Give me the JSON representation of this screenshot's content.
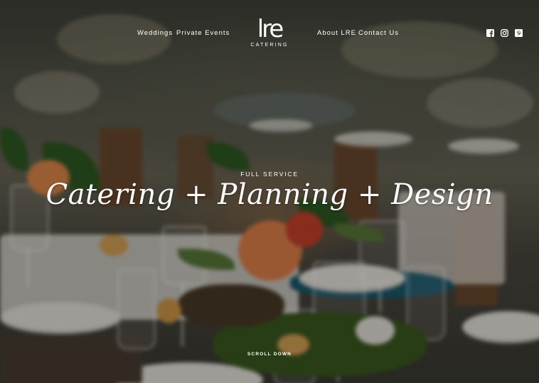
{
  "nav": {
    "left_links": [
      "Weddings",
      "Private Events"
    ],
    "right_links": [
      "About LRE",
      "Contact Us"
    ]
  },
  "logo": {
    "mark": "lre",
    "subtitle": "CATERING"
  },
  "social": [
    "facebook-icon",
    "instagram-icon",
    "pinterest-icon"
  ],
  "hero": {
    "eyebrow": "FULL SERVICE",
    "headline": "Catering + Planning + Design",
    "scroll_label": "SCROLL DOWN"
  },
  "colors": {
    "overlay": "#00000052",
    "text": "#ffffff",
    "napkin": "#1b5a6d",
    "flower": "#e2824a"
  }
}
